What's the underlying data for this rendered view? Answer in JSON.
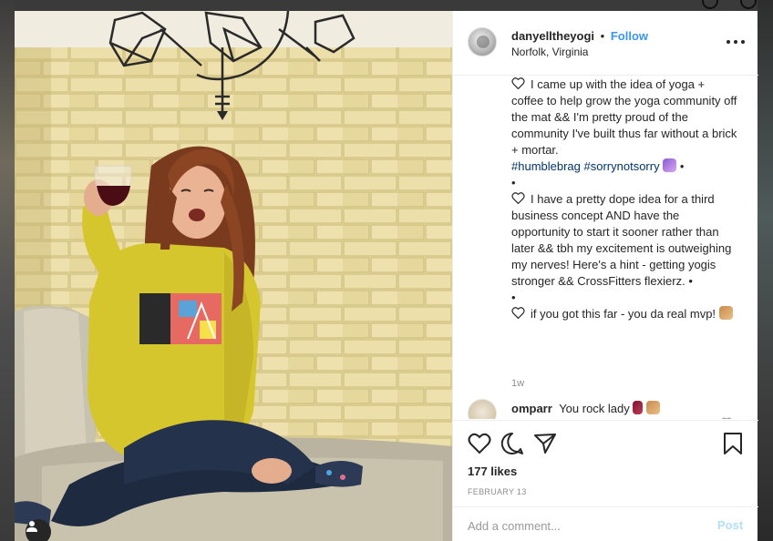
{
  "post": {
    "username": "danyelltheyogi",
    "separator": "•",
    "follow_label": "Follow",
    "location": "Norfolk, Virginia",
    "more_icon": "more-options-icon"
  },
  "caption": {
    "p1": "I came up with the idea of yoga + coffee to help grow the yoga community off the mat && I'm pretty proud of the community I've built thus far without a brick + mortar.",
    "hashtag1": "#humblebrag",
    "hashtag2": "#sorrynotsorry",
    "bullet": "•",
    "p2": "I have a pretty dope idea for a third business concept AND have the opportunity to start it sooner rather than later && tbh my excitement is outweighing my nerves! Here's a hint - getting yogis stronger && CrossFitters flexierz. •",
    "p3": "if you got this far - you da real mvp!",
    "time_ago": "1w"
  },
  "comment": {
    "username": "omparr",
    "text": "You rock lady"
  },
  "actions": {
    "likes": "177 likes",
    "date": "FEBRUARY 13",
    "icons": [
      "heart-icon",
      "comment-icon",
      "share-icon",
      "bookmark-icon"
    ]
  },
  "add_comment": {
    "placeholder": "Add a comment...",
    "post_label": "Post"
  },
  "colors": {
    "link_blue": "#3897f0",
    "post_disabled": "#b2dffc",
    "hashtag": "#003569"
  }
}
